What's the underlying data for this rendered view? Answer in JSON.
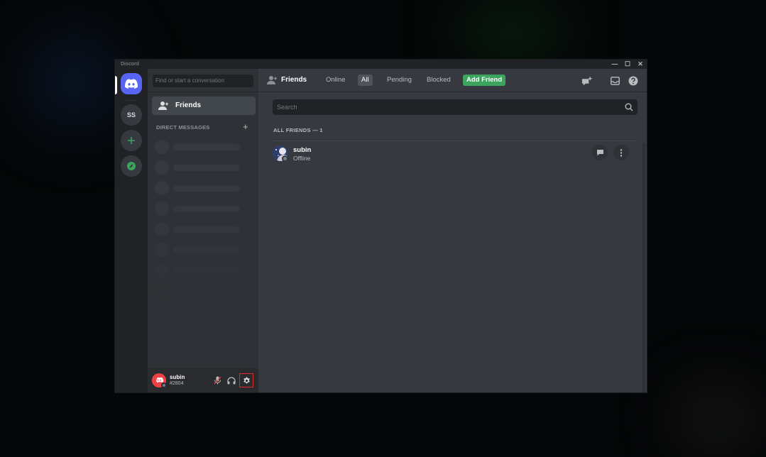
{
  "window": {
    "app_title": "Discord",
    "controls": {
      "minimize": "—",
      "maximize": "☐",
      "close": "✕"
    }
  },
  "guilds": [
    {
      "label": "",
      "icon": "discord-logo-icon",
      "selected": true
    },
    {
      "label": "SS",
      "icon": ""
    },
    {
      "label": "",
      "icon": "plus-icon",
      "color": "#3ba55d"
    },
    {
      "label": "",
      "icon": "compass-icon",
      "color": "#3ba55d"
    }
  ],
  "dm_sidebar": {
    "search_placeholder": "Find or start a conversation",
    "friends_label": "Friends",
    "direct_messages_header": "DIRECT MESSAGES",
    "add_dm": "+"
  },
  "user_panel": {
    "username": "subin",
    "discriminator": "#2804",
    "avatar_color": "#ed4245",
    "status": "offline"
  },
  "header": {
    "title": "Friends",
    "tabs": [
      {
        "label": "Online",
        "active": false
      },
      {
        "label": "All",
        "active": true
      },
      {
        "label": "Pending",
        "active": false
      },
      {
        "label": "Blocked",
        "active": false
      }
    ],
    "add_friend": "Add Friend"
  },
  "main": {
    "search_placeholder": "Search",
    "section_title": "ALL FRIENDS — 1",
    "friends": [
      {
        "name": "subin",
        "status": "Offline"
      }
    ]
  },
  "colors": {
    "blurple": "#5865f2",
    "green": "#3ba55d",
    "red": "#ed4245",
    "highlight_box": "#e02a2a"
  }
}
